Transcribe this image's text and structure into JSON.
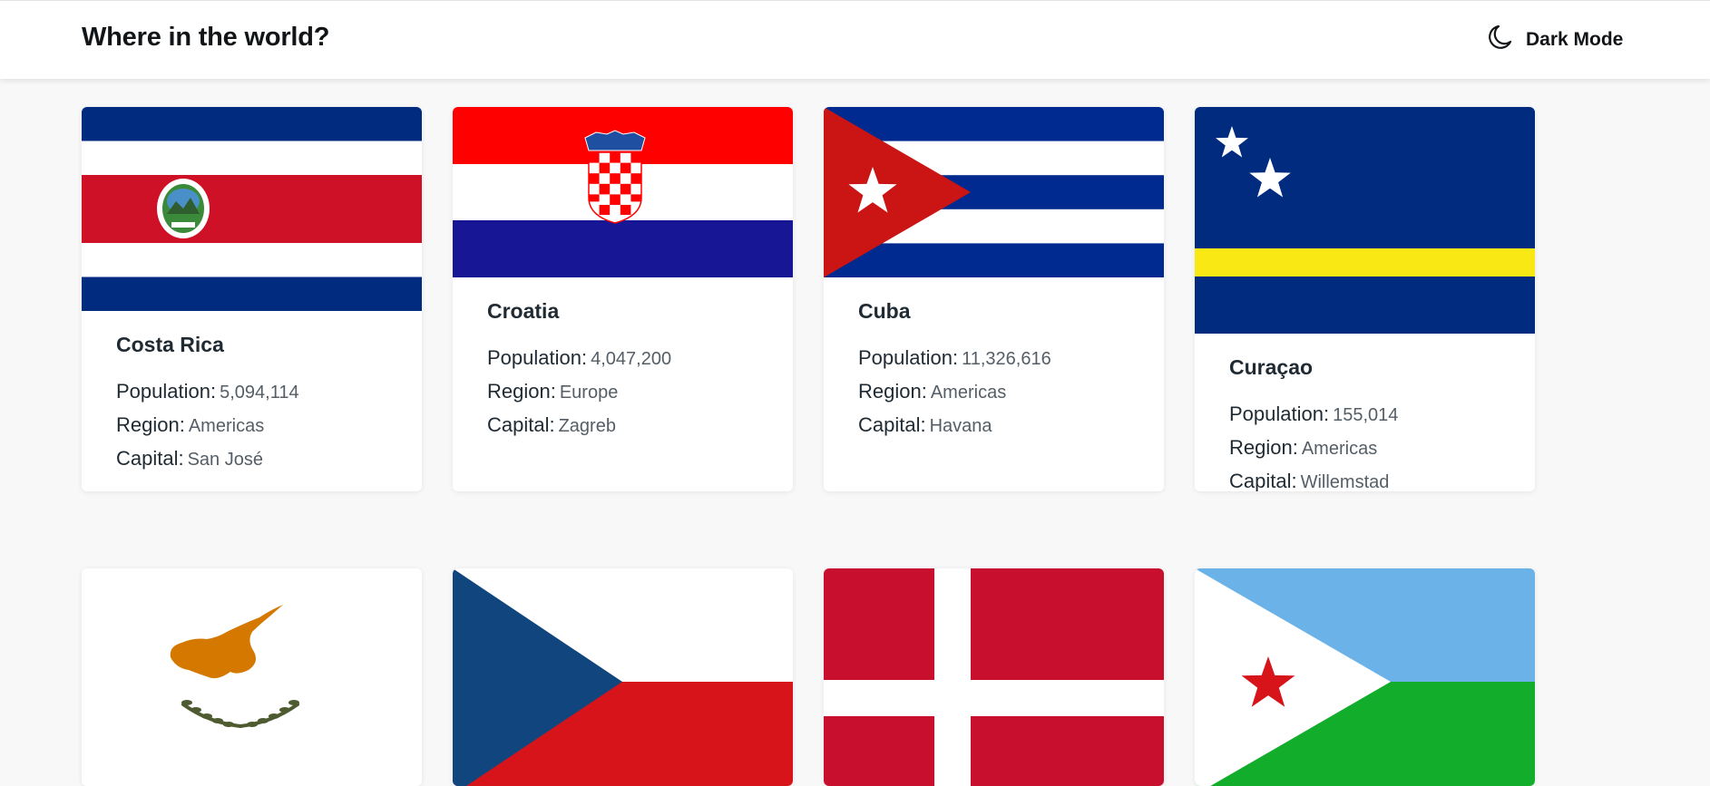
{
  "header": {
    "title": "Where in the world?",
    "mode_label": "Dark Mode",
    "mode_icon": "moon-icon"
  },
  "colors": {
    "background": "#f8f8f8",
    "card": "#ffffff",
    "text": "#111517"
  },
  "labels": {
    "population": "Population:",
    "region": "Region:",
    "capital": "Capital:"
  },
  "countries": [
    {
      "name": "Costa Rica",
      "population": "5,094,114",
      "region": "Americas",
      "capital": "San José",
      "flag": "costa-rica-flag"
    },
    {
      "name": "Croatia",
      "population": "4,047,200",
      "region": "Europe",
      "capital": "Zagreb",
      "flag": "croatia-flag"
    },
    {
      "name": "Cuba",
      "population": "11,326,616",
      "region": "Americas",
      "capital": "Havana",
      "flag": "cuba-flag"
    },
    {
      "name": "Curaçao",
      "population": "155,014",
      "region": "Americas",
      "capital": "Willemstad",
      "flag": "curacao-flag"
    },
    {
      "flag": "cyprus-flag"
    },
    {
      "flag": "czechia-flag"
    },
    {
      "flag": "denmark-flag"
    },
    {
      "flag": "djibouti-flag"
    }
  ]
}
